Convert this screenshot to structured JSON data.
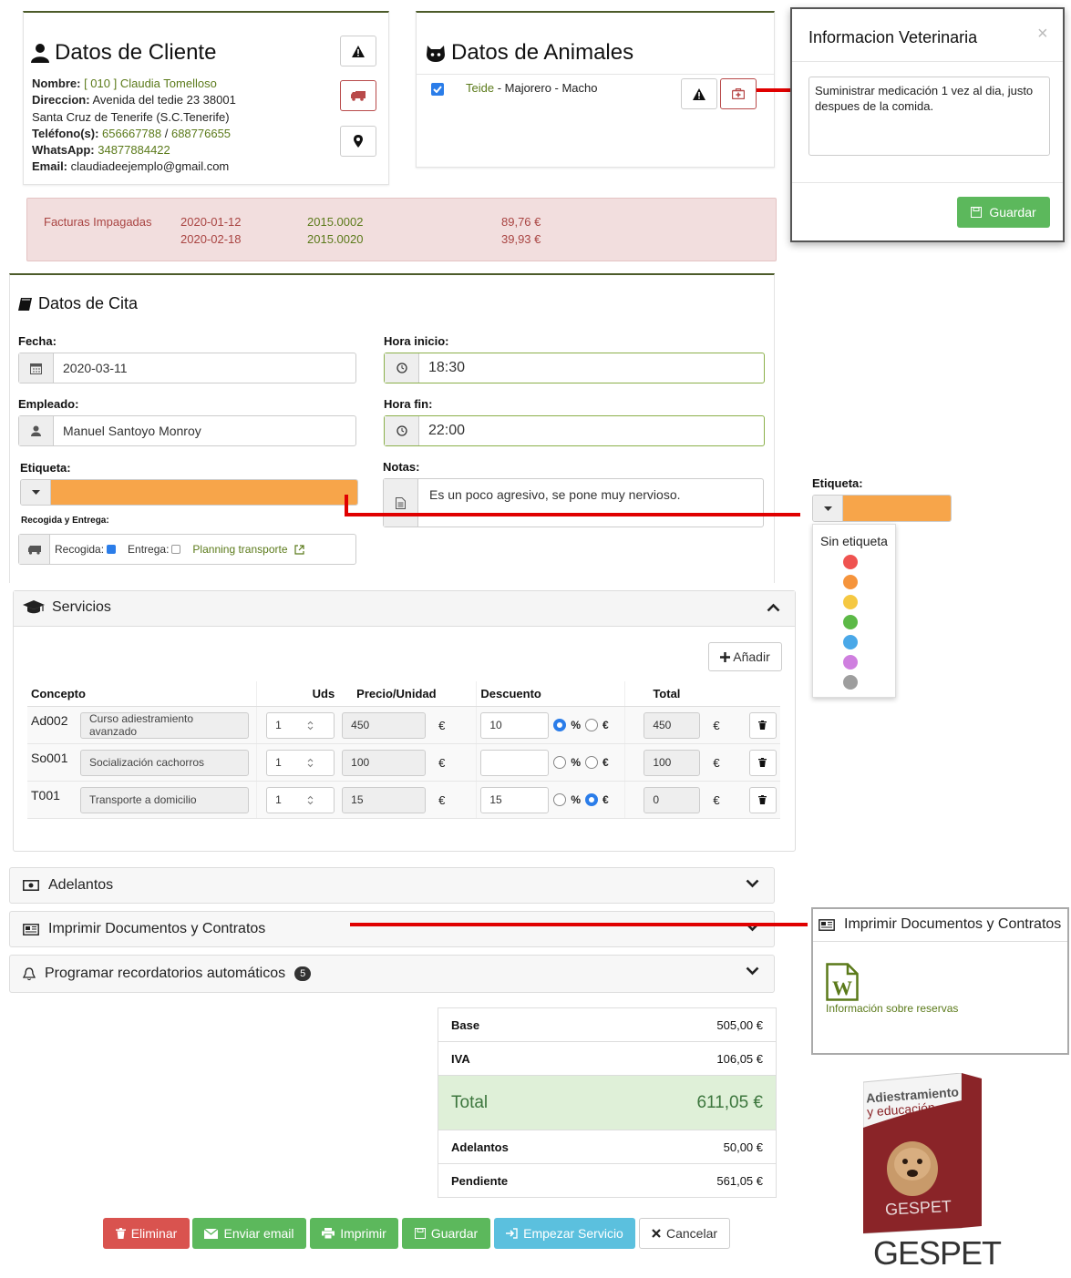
{
  "cliente": {
    "title": "Datos de Cliente",
    "nombre_label": "Nombre:",
    "nombre_value": "[ 010 ] Claudia Tomelloso",
    "direccion_label": "Direccion:",
    "direccion_value": "Avenida del tedie 23   38001",
    "ciudad": "Santa Cruz de Tenerife (S.C.Tenerife)",
    "telefono_label": "Teléfono(s):",
    "telefono1": "656667788",
    "telefono_sep": " / ",
    "telefono2": "688776655",
    "whatsapp_label": "WhatsApp:",
    "whatsapp_value": "34877884422",
    "email_label": "Email:",
    "email_value": "claudiadeejemplo@gmail.com"
  },
  "animales": {
    "title": "Datos de Animales",
    "animal_name": "Teide",
    "animal_details": " - Majorero - Macho"
  },
  "vet_modal": {
    "title": "Informacion Veterinaria",
    "close": "×",
    "text": "Suministrar medicación 1 vez al dia, justo despues de la comida.",
    "save": "Guardar"
  },
  "facturas": {
    "label": "Facturas Impagadas",
    "rows": [
      {
        "date": "2020-01-12",
        "num": "2015.0002",
        "amount": "89,76 €"
      },
      {
        "date": "2020-02-18",
        "num": "2015.0020",
        "amount": "39,93 €"
      }
    ]
  },
  "cita": {
    "title": "Datos de Cita",
    "fecha_label": "Fecha:",
    "fecha_value": "2020-03-11",
    "hora_inicio_label": "Hora inicio:",
    "hora_inicio_value": "18:30",
    "empleado_label": "Empleado:",
    "empleado_value": "Manuel Santoyo Monroy",
    "hora_fin_label": "Hora fin:",
    "hora_fin_value": "22:00",
    "etiqueta_label": "Etiqueta:",
    "notas_label": "Notas:",
    "notas_value": "Es un poco agresivo, se pone muy nervioso.",
    "recogida_title": "Recogida y Entrega:",
    "recogida_label": "Recogida:",
    "entrega_label": "Entrega:",
    "planning": "Planning transporte"
  },
  "etiqueta_popup": {
    "label": "Etiqueta:",
    "none": "Sin etiqueta",
    "colors": [
      "#ef5350",
      "#f5943c",
      "#f5c842",
      "#5cb947",
      "#4aa8e8",
      "#cf7fdf",
      "#9e9e9e"
    ],
    "selected_color": "#f7a54a"
  },
  "servicios": {
    "title": "Servicios",
    "add": "Añadir",
    "headers": {
      "concepto": "Concepto",
      "uds": "Uds",
      "precio": "Precio/Unidad",
      "descuento": "Descuento",
      "total": "Total"
    },
    "rows": [
      {
        "code": "Ad002",
        "name": "Curso adiestramiento avanzado",
        "uds": "1",
        "precio": "450",
        "descuento": "10",
        "pct": true,
        "total": "450"
      },
      {
        "code": "So001",
        "name": "Socialización cachorros",
        "uds": "1",
        "precio": "100",
        "descuento": "",
        "pct": false,
        "total": "100"
      },
      {
        "code": "T001",
        "name": "Transporte a domicilio",
        "uds": "1",
        "precio": "15",
        "descuento": "15",
        "pct": false,
        "total": "0"
      }
    ],
    "currency": "€",
    "pct_symbol": "%"
  },
  "accordions": {
    "adelantos": "Adelantos",
    "imprimir": "Imprimir Documentos y Contratos",
    "recordatorios": "Programar recordatorios automáticos",
    "recordatorios_badge": "5"
  },
  "docs_popup": {
    "title": "Imprimir Documentos y Contratos",
    "doc_link": "Información sobre reservas"
  },
  "resumen": {
    "base_label": "Base",
    "base_value": "505,00 €",
    "iva_label": "IVA",
    "iva_value": "106,05 €",
    "total_label": "Total",
    "total_value": "611,05 €",
    "adelantos_label": "Adelantos",
    "adelantos_value": "50,00 €",
    "pendiente_label": "Pendiente",
    "pendiente_value": "561,05 €"
  },
  "buttons": {
    "eliminar": "Eliminar",
    "email": "Enviar email",
    "imprimir": "Imprimir",
    "guardar": "Guardar",
    "empezar": "Empezar Servicio",
    "cancelar": "Cancelar"
  },
  "product": {
    "box_title": "Adiestramiento",
    "box_subtitle": "y educación",
    "box_logo": "GESPET",
    "brand": "GESPET"
  },
  "colors": {
    "accent_green": "#5cb85c",
    "danger": "#d9534f",
    "info": "#5bc0de",
    "link_green": "#5b7a1a",
    "alert_bg": "#f2dede"
  }
}
